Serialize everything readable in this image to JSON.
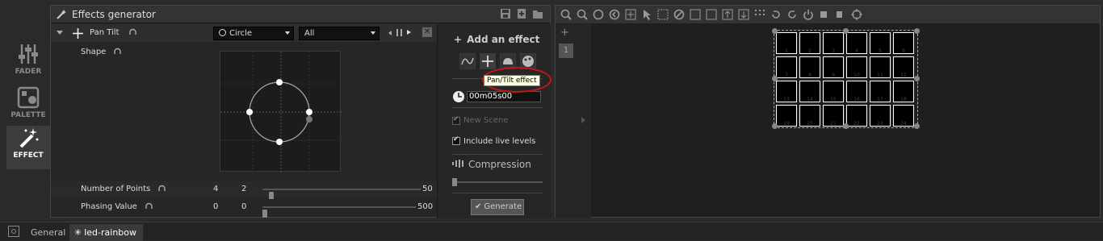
{
  "rail": {
    "items": [
      {
        "label": "FADER",
        "icon": "sliders-icon"
      },
      {
        "label": "PALETTE",
        "icon": "palette-icon"
      },
      {
        "label": "EFFECT",
        "icon": "magic-wand-icon"
      }
    ]
  },
  "panel": {
    "title": "Effects generator",
    "effect_type": "Pan Tilt",
    "shape_select": "Circle",
    "target_select": "All",
    "shape_label": "Shape",
    "params": [
      {
        "label": "Number of Points",
        "v1": "4",
        "v2": "2",
        "max": "50",
        "level": 0.04
      },
      {
        "label": "Phasing Value",
        "v1": "0",
        "v2": "0",
        "max": "500",
        "level": 0.0
      }
    ]
  },
  "side": {
    "add_effect": "Add an effect",
    "tooltip": "Pan/Tilt effect",
    "time_value": "00m05s00",
    "new_scene": "New Scene",
    "include_live": "Include live levels",
    "compression": "Compression",
    "generate": "Generate"
  },
  "viz": {
    "row_number": "1",
    "cells": [
      "1",
      "2",
      "3",
      "4",
      "5",
      "6",
      "7",
      "8",
      "9",
      "10",
      "11",
      "12",
      "13",
      "14",
      "15",
      "16",
      "17",
      "18",
      "19",
      "20",
      "21",
      "22",
      "23",
      "24"
    ]
  },
  "status": {
    "tab_general": "General",
    "tab_scene": "led-rainbow"
  },
  "colors": {
    "accent": "#c0c0c0",
    "highlight_ring": "#c01818",
    "tooltip_bg": "#ffffe1"
  }
}
